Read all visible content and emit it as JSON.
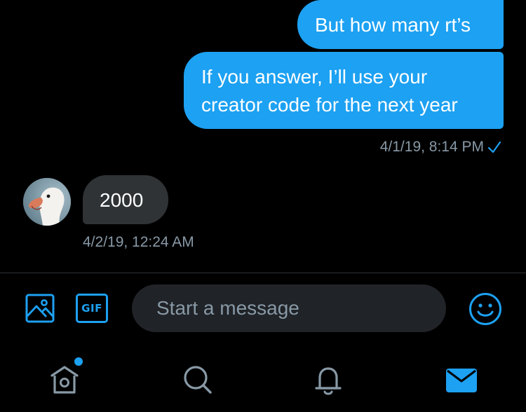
{
  "conversation": {
    "messages": [
      {
        "direction": "outgoing",
        "text": "But how many rt’s"
      },
      {
        "direction": "outgoing",
        "text": "If you answer, I’ll use your creator code for the next year"
      },
      {
        "direction": "incoming",
        "text": "2000"
      }
    ],
    "outgoing_timestamp": "4/1/19, 8:14 PM",
    "incoming_timestamp": "4/2/19, 12:24 AM",
    "read_receipt_icon": "check-icon"
  },
  "composer": {
    "media_icon": "image-icon",
    "gif_label": "GIF",
    "placeholder": "Start a message",
    "value": "",
    "emoji_icon": "smiley-icon"
  },
  "tab_bar": {
    "tabs": [
      {
        "name": "home",
        "icon": "home-icon",
        "has_notification_dot": true
      },
      {
        "name": "search",
        "icon": "search-icon"
      },
      {
        "name": "notifications",
        "icon": "bell-icon"
      },
      {
        "name": "messages",
        "icon": "envelope-icon",
        "active": true
      }
    ]
  },
  "colors": {
    "accent": "#1da1f2",
    "background": "#000000",
    "incoming_bubble": "#2f3336",
    "muted_text": "#8899a6"
  }
}
